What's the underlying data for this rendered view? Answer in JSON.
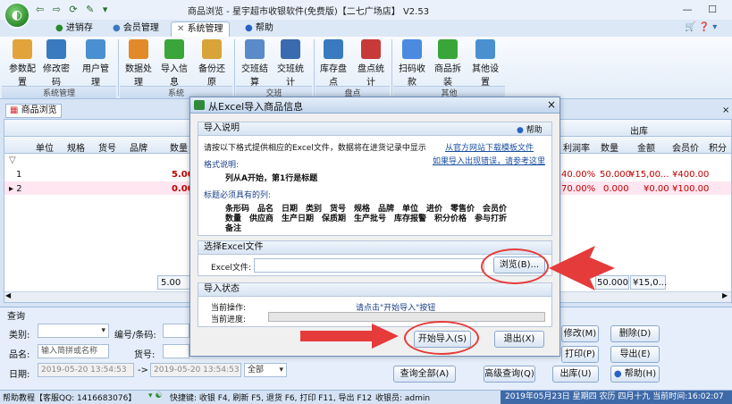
{
  "window": {
    "title": "商品浏览 - 星宇超市收银软件(免费版)【二七广场店】 V2.53",
    "controls": [
      "—",
      "☐",
      "✕"
    ]
  },
  "quick_access": "⇦ ⇨ ⟳ ✎ ▾",
  "menu": {
    "tabs": [
      "进销存",
      "会员管理",
      "系统管理",
      "帮助"
    ],
    "active": "系统管理",
    "right_icons": "🛒 ❓ ▾"
  },
  "ribbon": {
    "buttons": [
      "参数配置",
      "修改密码",
      "用户管理",
      "数据处理",
      "导入信息",
      "备份还原",
      "交班结算",
      "交班统计",
      "库存盘点",
      "盘点统计",
      "扫码收款",
      "商品拆装",
      "其他设置"
    ],
    "groups": [
      "系统管理",
      "系统",
      "交班",
      "盘点",
      "其他"
    ]
  },
  "doc_tab": "商品浏览",
  "grid": {
    "headers": [
      "单位",
      "规格",
      "货号",
      "品牌",
      "数量"
    ],
    "right_group": "出库",
    "right_headers": [
      "利润率",
      "数量",
      "金额",
      "会员价",
      "积分"
    ],
    "filter_row": "▽",
    "rows": [
      {
        "indicator": "1",
        "qty": "5.00",
        "profit": "40.00%",
        "out_qty": "50.000",
        "out_amount": "¥15,00...",
        "member_price": "¥400.00"
      },
      {
        "indicator": "▸ 2",
        "qty": "0.00",
        "profit": "70.00%",
        "out_qty": "0.000",
        "out_amount": "¥0.00",
        "member_price": "¥100.00"
      }
    ],
    "footer_qty": "5.00",
    "footer_out_qty": "50.000",
    "footer_out_amount": "¥15,0..."
  },
  "query": {
    "title": "查询",
    "category_label": "类别:",
    "code_label": "编号/条码:",
    "name_label": "品名:",
    "name_placeholder": "输入简拼或名称",
    "item_no_label": "货号:",
    "date_label": "日期:",
    "date_from": "2019-05-20 13:54:53",
    "date_to": "2019-05-20 13:54:53",
    "range": "全部",
    "buttons": {
      "query_all": "查询全部(A)",
      "advanced": "高级查询(Q)",
      "modify": "修改(M)",
      "delete": "删除(D)",
      "print": "打印(P)",
      "export": "导出(E)",
      "outbound": "出库(U)",
      "help": "帮助(H)"
    }
  },
  "statusbar": {
    "help": "帮助教程【客服QQ: 1416683076】",
    "shortcuts": "快捷键: 收银 F4, 刷新 F5, 退货 F6, 打印 F11, 导出 F12",
    "cashier": "收银员: admin",
    "datetime": "2019年05月23日 星期四 农历 四月十九 当前时间:16:02:07"
  },
  "dialog": {
    "title": "从Excel导入商品信息",
    "close": "×",
    "section1": {
      "header": "导入说明",
      "help": "帮助",
      "intro": "请按以下格式提供相应的Excel文件，数据将在进货记录中显示",
      "link1": "从官方网站下载模板文件",
      "link2": "如果导入出现错误，请参考这里",
      "format_title": "格式说明:",
      "format_text": "列从A开始，第1行是标题",
      "required_title": "标题必须具有的列:",
      "columns_line1": "条形码　品名　日期　类别　货号　规格　品牌　单位　进价　零售价　会员价",
      "columns_line2": "数量　供应商　生产日期　保质期　生产批号　库存报警　积分价格　参与打折",
      "columns_line3": "备注"
    },
    "section2": {
      "header": "选择Excel文件",
      "file_label": "Excel文件:",
      "file_value": "",
      "browse": "浏览(B)..."
    },
    "section3": {
      "header": "导入状态",
      "op_label": "当前操作:",
      "op_value": "请点击\"开始导入\"按钮",
      "progress_label": "当前进度:",
      "progress": 0
    },
    "start": "开始导入(S)",
    "exit": "退出(X)"
  },
  "colors": {
    "accent": "#e53b3b",
    "link": "#1b4fa0",
    "red_text": "#c00000"
  }
}
